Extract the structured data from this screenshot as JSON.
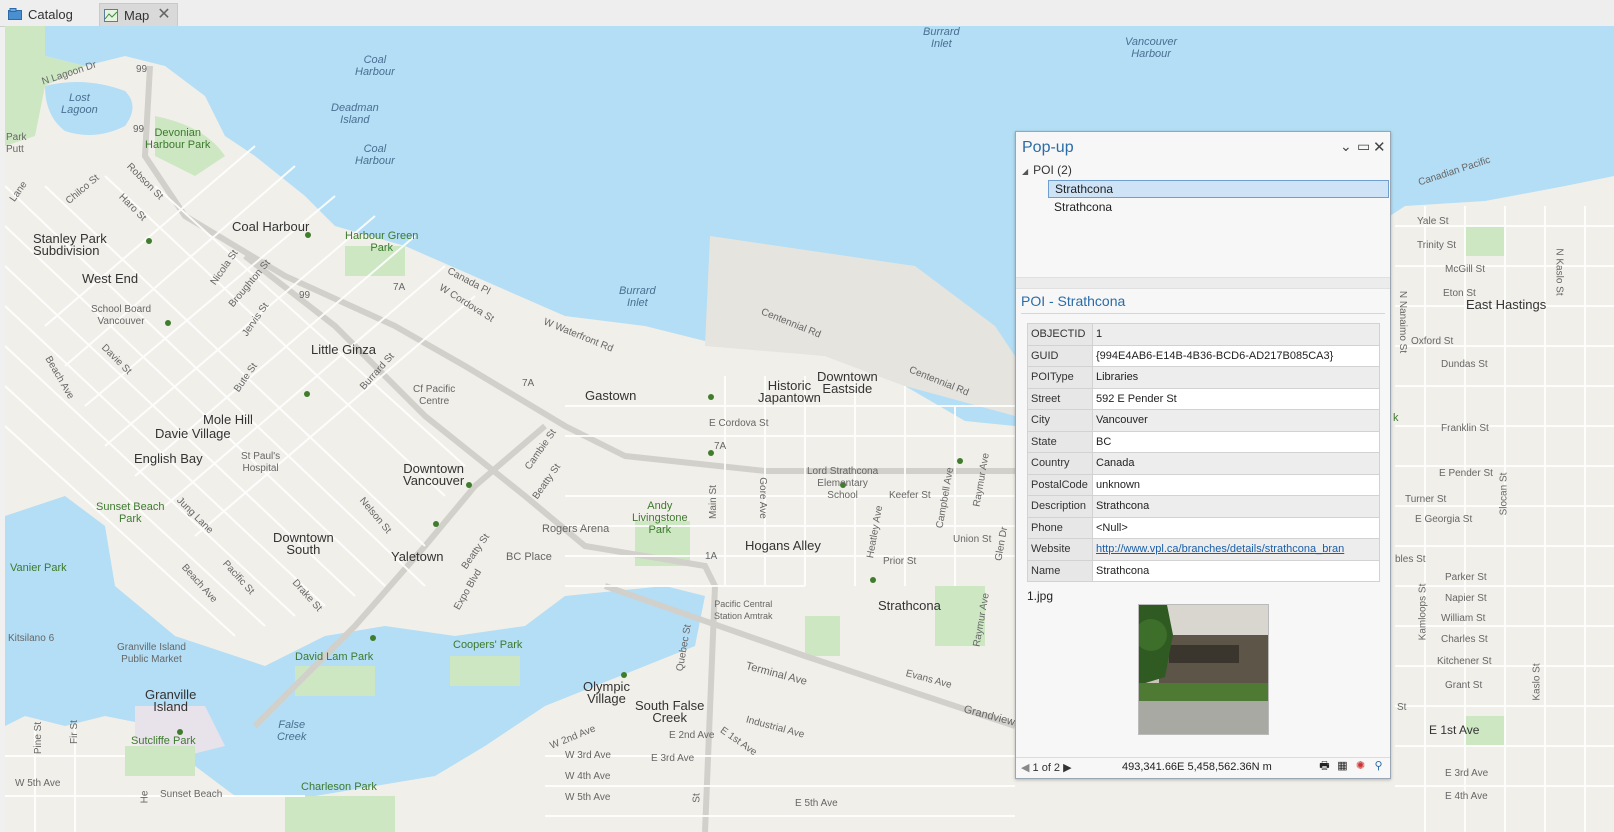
{
  "tabs": {
    "catalog_label": "Catalog",
    "map_label": "Map",
    "close_glyph": "✕"
  },
  "map": {
    "labels": {
      "burrard_inlet_n": "Burrard\nInlet",
      "vancouver_harbour": "Vancouver\nHarbour",
      "n_lagoon_dr": "N Lagoon Dr",
      "hwy99a": "99",
      "hwy99b": "99",
      "hwy99c": "99",
      "hwy7a_1": "7A",
      "hwy7a_2": "7A",
      "hwy7a_3": "7A",
      "hwy1a": "1A",
      "coal_harbour_water": "Coal\nHarbour",
      "deadman_island": "Deadman\nIsland",
      "coal_harbour_water2": "Coal\nHarbour",
      "lost_lagoon": "Lost\nLagoon",
      "devonian_park": "Devonian\nHarbour Park",
      "park_putt": "Park\nPutt",
      "lane": "Lane",
      "chilco_st": "Chilco St",
      "robson_st": "Robson St",
      "haro_st": "Haro St",
      "stanley_park_sub": "Stanley Park\nSubdivision",
      "coal_harbour": "Coal Harbour",
      "harbour_green_park": "Harbour Green\nPark",
      "west_end": "West End",
      "nicola_st": "Nicola St",
      "broughton_st": "Broughton St",
      "canada_pl": "Canada Pl",
      "w_cordova_st": "W Cordova St",
      "school_board": "School Board\nVancouver",
      "jervis_st": "Jervis St",
      "burrard_inlet": "Burrard\nInlet",
      "w_waterfront_rd": "W Waterfront Rd",
      "centennial_rd": "Centennial Rd",
      "davie_st": "Davie St",
      "little_ginza": "Little Ginza",
      "burrard_st": "Burrard St",
      "bute_st": "Bute St",
      "beach_ave": "Beach Ave",
      "cf_pacific": "Cf Pacific\nCentre",
      "gastown": "Gastown",
      "historic_japantown": "Historic\nJapantown",
      "downtown_eastside": "Downtown\nEastside",
      "centennial_rd2": "Centennial Rd",
      "e_cordova_st": "E Cordova St",
      "mole_hill": "Mole Hill",
      "davie_village": "Davie Village",
      "english_bay": "English Bay",
      "st_pauls": "St Paul's\nHospital",
      "cambie_st": "Cambie St",
      "downtown_vancouver": "Downtown\nVancouver",
      "beatty_st": "Beatty St",
      "lord_strathcona": "Lord Strathcona\nElementary\nSchool",
      "gore_ave": "Gore Ave",
      "main_st": "Main St",
      "keefer_st": "Keefer St",
      "campbell_ave": "Campbell Ave",
      "raymur_ave": "Raymur Ave",
      "sunset_beach_park": "Sunset Beach\nPark",
      "jung_lane": "Jung Lane",
      "nelson_st": "Nelson St",
      "andy_livingstone": "Andy\nLivingstone\nPark",
      "rogers_arena": "Rogers Arena",
      "hogans_alley": "Hogans Alley",
      "heatley_ave": "Heatley Ave",
      "union_st": "Union St",
      "glen_dr": "Glen Dr",
      "downtown_south": "Downtown\nSouth",
      "yaletown": "Yaletown",
      "bc_place": "BC Place",
      "beatty_st2": "Beatty St",
      "vanier_park": "Vanier Park",
      "beach_ave2": "Beach Ave",
      "pacific_st": "Pacific St",
      "drake_st": "Drake St",
      "expo_blvd": "Expo Blvd",
      "prior_st": "Prior St",
      "strathcona": "Strathcona",
      "raymur_ave2": "Raymur Ave",
      "pacific_central": "Pacific Central\nStation Amtrak",
      "kitsilano": "Kitsilano 6",
      "granville_market": "Granville Island\nPublic Market",
      "david_lam_park": "David Lam Park",
      "coopers_park": "Coopers' Park",
      "quebec_st": "Quebec St",
      "terminal_ave": "Terminal Ave",
      "evans_ave": "Evans Ave",
      "granville_island": "Granville\nIsland",
      "olympic_village": "Olympic\nVillage",
      "south_false_creek": "South False\nCreek",
      "false_creek": "False\nCreek",
      "industrial_ave": "Industrial Ave",
      "grandview": "Grandview",
      "pine_st": "Pine St",
      "fir_st": "Fir St",
      "sutcliffe_park": "Sutcliffe Park",
      "w_2nd_ave": "W 2nd Ave",
      "e_2nd_ave": "E 2nd Ave",
      "e_1st_ave_diag": "E 1st Ave",
      "w_3rd_ave": "W 3rd Ave",
      "e_3rd_ave": "E 3rd Ave",
      "w_4th_ave": "W 4th Ave",
      "w_5th_ave_l": "W 5th Ave",
      "sunset_beach": "Sunset Beach",
      "charleson_park": "Charleson Park",
      "w_5th_ave": "W 5th Ave",
      "e_5th_ave": "E 5th Ave",
      "he": "He",
      "st": "St",
      "canadian_pacific": "Canadian Pacific",
      "yale_st": "Yale St",
      "trinity_st": "Trinity St",
      "mcgill_st": "McGill St",
      "eton_st": "Eton St",
      "east_hastings": "East Hastings",
      "oxford_st": "Oxford St",
      "dundas_st": "Dundas St",
      "franklin_st": "Franklin St",
      "e_pender_st": "E Pender St",
      "turner_st": "Turner St",
      "e_georgia_st": "E Georgia St",
      "bles_st": "bles St",
      "parker_st": "Parker St",
      "napier_st": "Napier St",
      "william_st": "William St",
      "charles_st": "Charles St",
      "kitchener_st": "Kitchener St",
      "grant_st": "Grant St",
      "e_1st_ave": "E 1st Ave",
      "e_3rd_ave_r": "E 3rd Ave",
      "e_4th_ave": "E 4th Ave",
      "n_nanaimo_st": "N Nanaimo St",
      "n_kaslo_st": "N Kaslo St",
      "slocan_st": "Slocan St",
      "kamloops_st": "Kamloops St",
      "kaslo_st": "Kaslo St",
      "k": "k",
      "st_frag": "St"
    }
  },
  "popup": {
    "title": "Pop-up",
    "collapse_glyph": "⌄",
    "maximize_glyph": "▭",
    "close_glyph": "✕",
    "tree_root": "POI (2)",
    "tree_items": [
      "Strathcona",
      "Strathcona"
    ],
    "subtitle": "POI - Strathcona",
    "attributes": [
      {
        "key": "OBJECTID",
        "value": "1"
      },
      {
        "key": "GUID",
        "value": "{994E4AB6-E14B-4B36-BCD6-AD217B085CA3}"
      },
      {
        "key": "POIType",
        "value": "Libraries"
      },
      {
        "key": "Street",
        "value": "592 E Pender St"
      },
      {
        "key": "City",
        "value": "Vancouver"
      },
      {
        "key": "State",
        "value": "BC"
      },
      {
        "key": "Country",
        "value": "Canada"
      },
      {
        "key": "PostalCode",
        "value": "unknown"
      },
      {
        "key": "Description",
        "value": "Strathcona"
      },
      {
        "key": "Phone",
        "value": "<Null>"
      },
      {
        "key": "Website",
        "value": "http://www.vpl.ca/branches/details/strathcona_bran"
      },
      {
        "key": "Name",
        "value": "Strathcona"
      }
    ],
    "attachment_name": "1.jpg",
    "nav_text": "1 of 2",
    "coordinates": "493,341.66E 5,458,562.36N m",
    "colors": {
      "title": "#2b6ca8",
      "selection": "#cfe3f7",
      "link": "#1a5ea8",
      "water": "#b3def5",
      "park": "#cde7c3"
    }
  }
}
